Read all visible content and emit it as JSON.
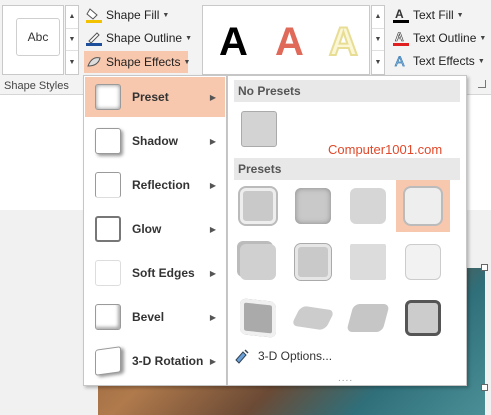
{
  "ribbon": {
    "style_thumb": "Abc",
    "shape_fill": "Shape Fill",
    "shape_outline": "Shape Outline",
    "shape_effects": "Shape Effects",
    "group_label": "Shape Styles",
    "wordart_letters": [
      "A",
      "A",
      "A"
    ],
    "text_fill": "Text Fill",
    "text_outline": "Text Outline",
    "text_effects": "Text Effects",
    "colors": {
      "fill_bar": "#f2c200",
      "outline_bar": "#1f4e9a",
      "text_fill_bar": "#000000",
      "text_outline_bar": "#e02020",
      "wordart_red": "#e06a5a",
      "wordart_pale": "#f4ecb0"
    }
  },
  "menu": {
    "items": [
      {
        "label": "Preset",
        "accel": "P",
        "highlighted": true
      },
      {
        "label": "Shadow",
        "accel": "S"
      },
      {
        "label": "Reflection",
        "accel": "R"
      },
      {
        "label": "Glow",
        "accel": "G"
      },
      {
        "label": "Soft Edges",
        "accel": "E"
      },
      {
        "label": "Bevel",
        "accel": "B"
      },
      {
        "label": "3-D Rotation",
        "accel": "D"
      }
    ]
  },
  "submenu": {
    "no_presets_header": "No Presets",
    "presets_header": "Presets",
    "watermark": "Computer1001.com",
    "options_label": "3-D Options...",
    "dots": "....",
    "selected_preset_index": 3
  },
  "accent": "#f7c7ae"
}
